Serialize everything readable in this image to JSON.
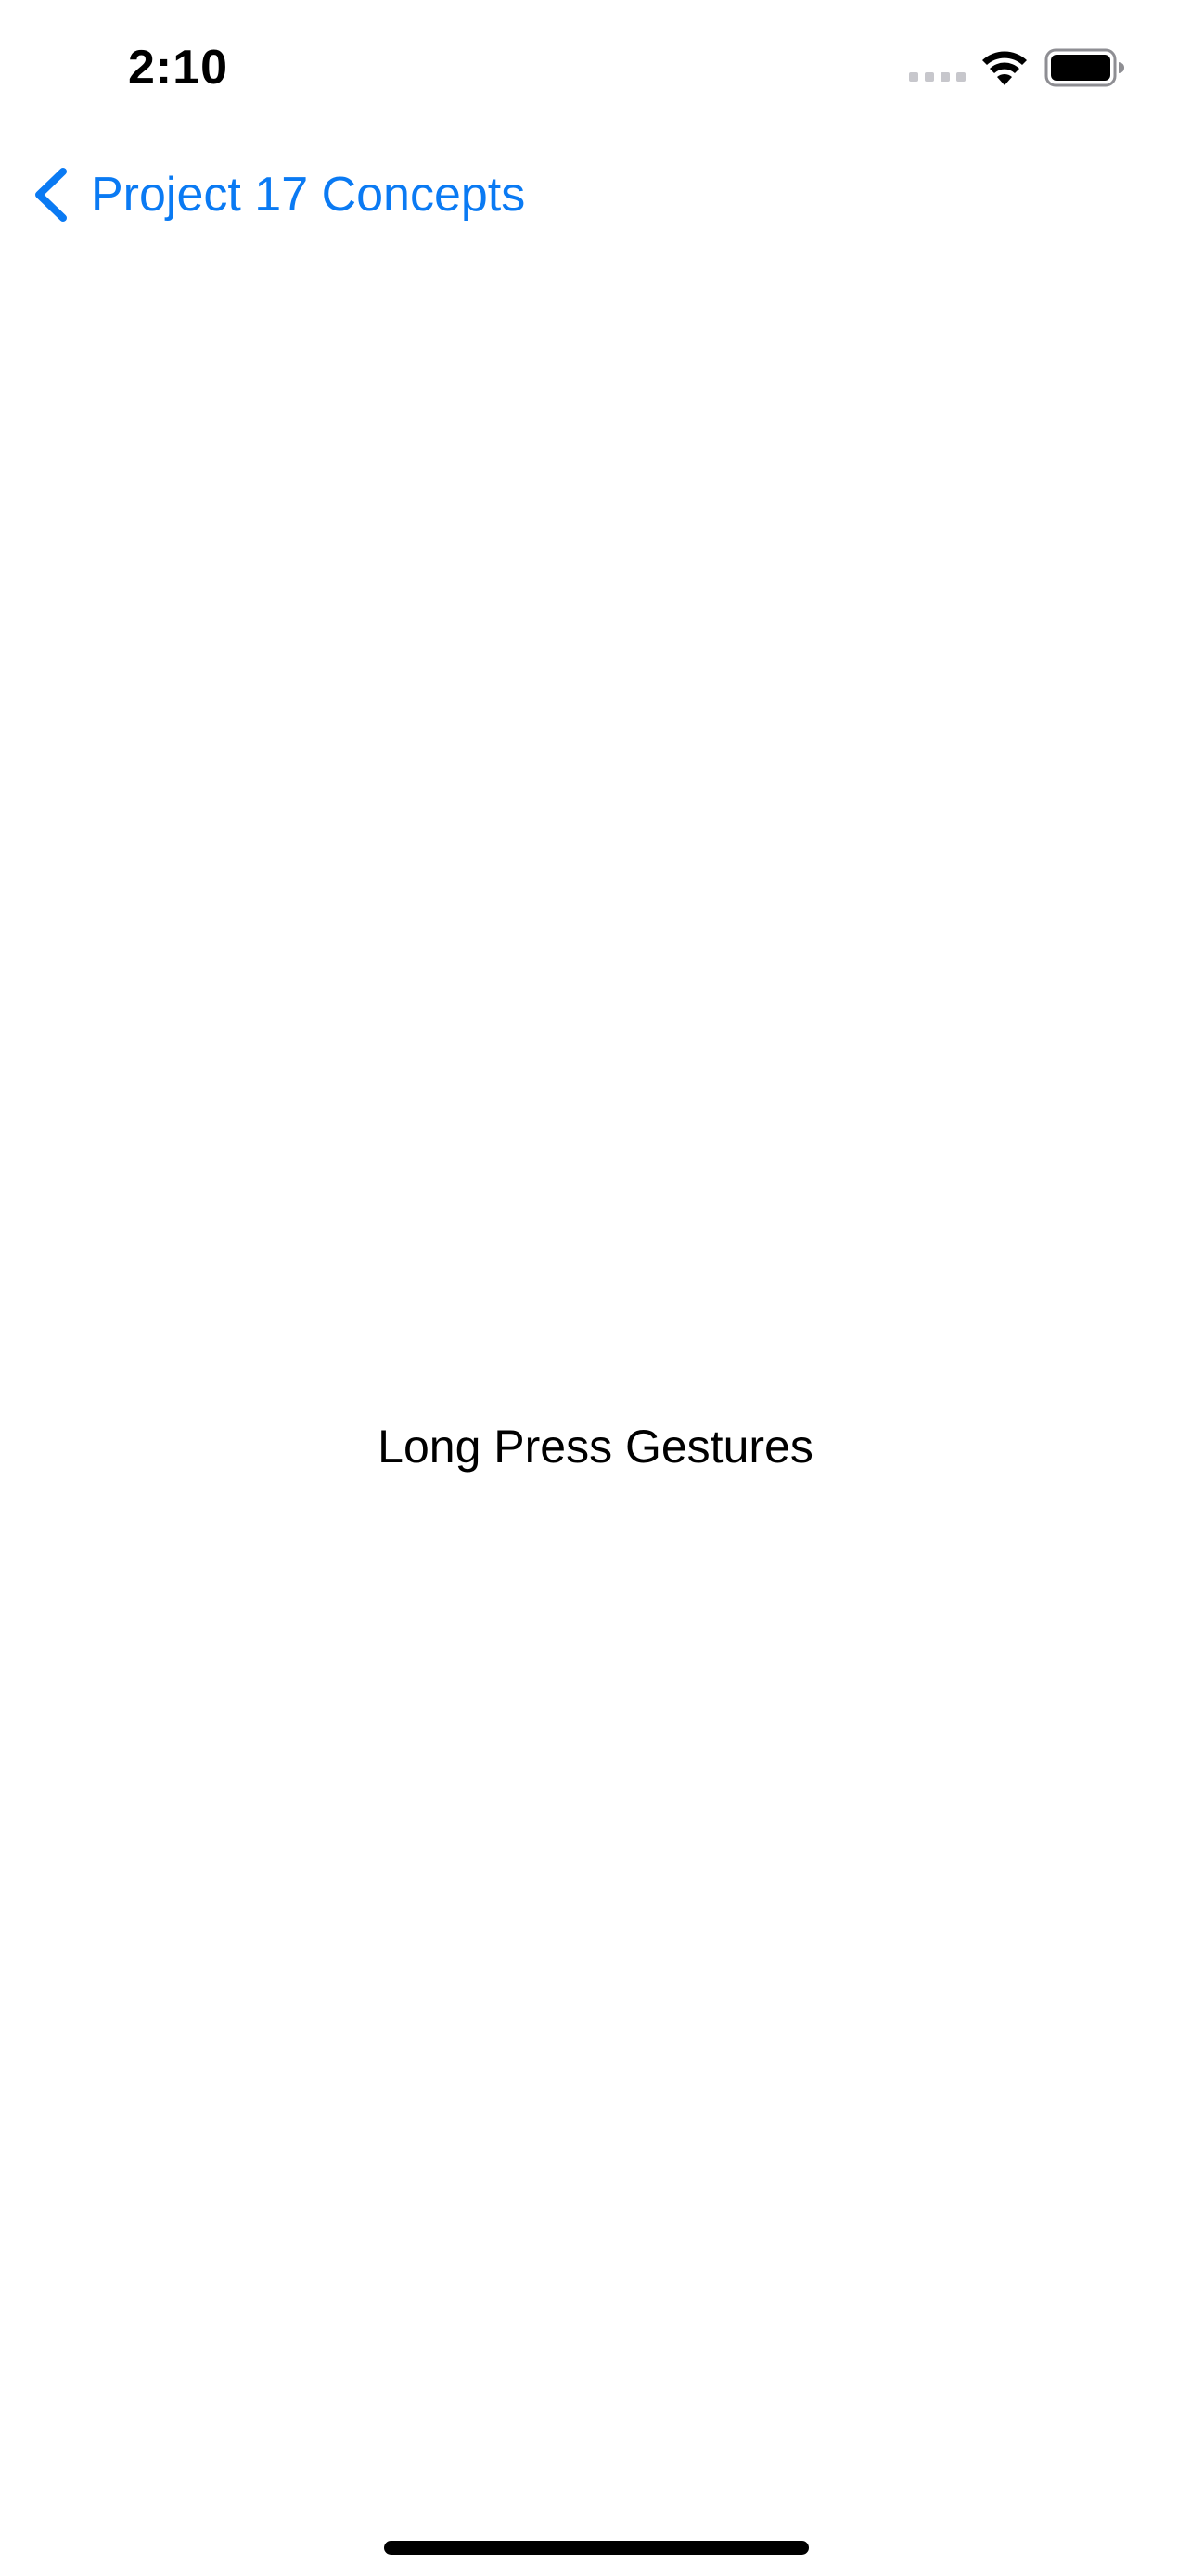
{
  "status_bar": {
    "time": "2:10",
    "icons": [
      "cellular-signal-icon",
      "wifi-icon",
      "battery-icon"
    ]
  },
  "nav": {
    "back_label": "Project 17 Concepts",
    "back_icon": "chevron-left-icon",
    "accent_color": "#0a7af3"
  },
  "content": {
    "text": "Long Press Gestures"
  }
}
